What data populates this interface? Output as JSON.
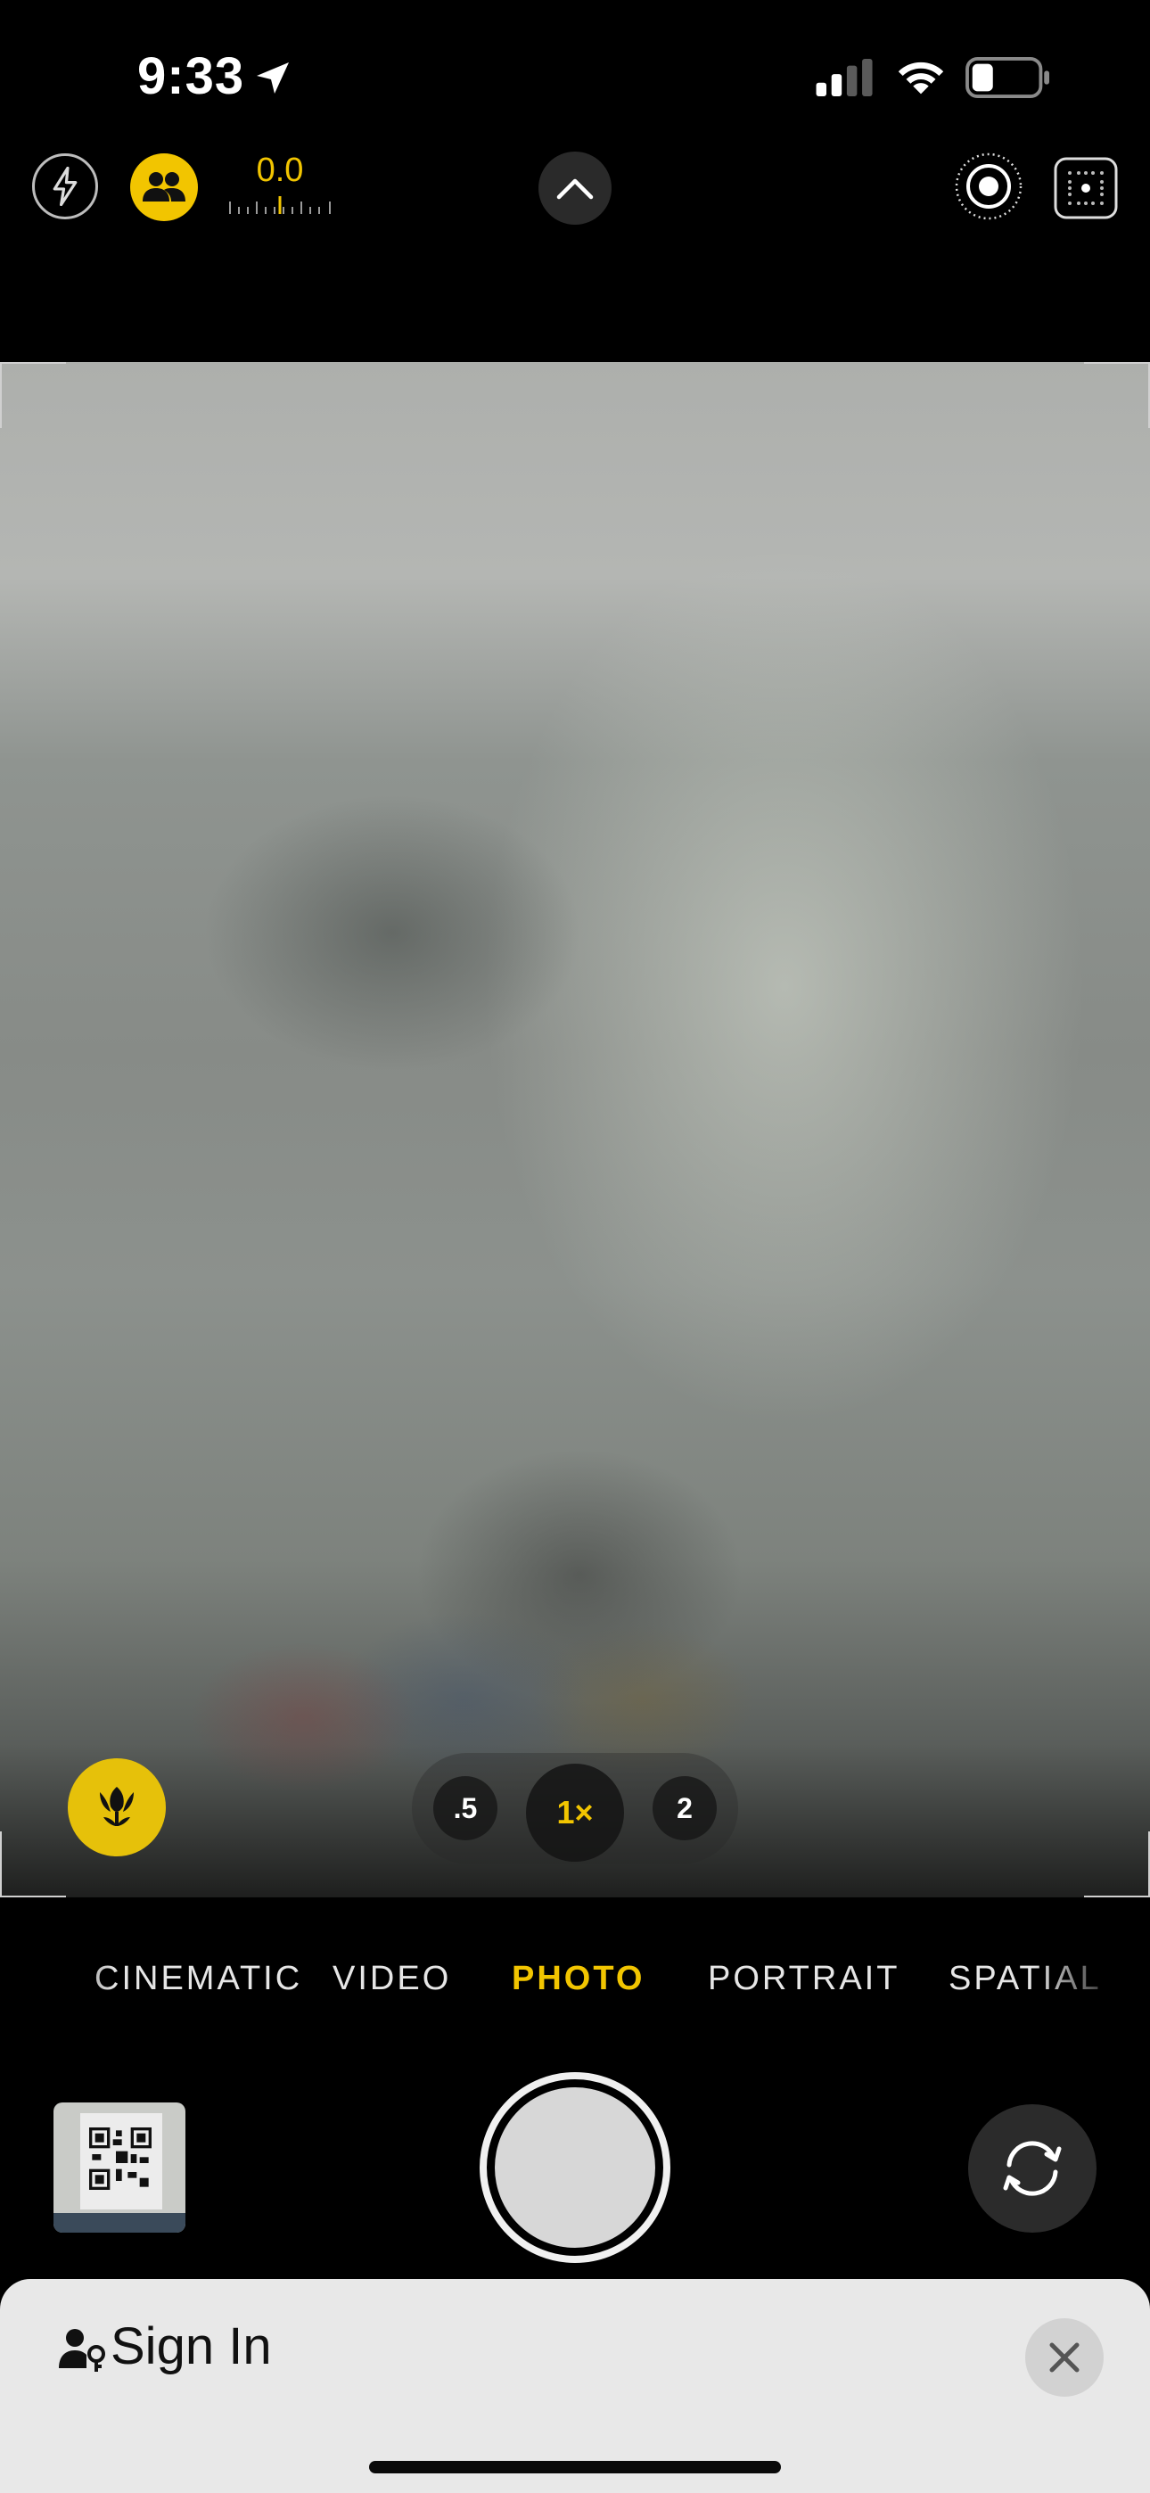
{
  "status_bar": {
    "time": "9:33"
  },
  "top_controls": {
    "exposure_value": "0.0"
  },
  "zoom": {
    "options": [
      ".5",
      "1×",
      "2"
    ],
    "selected": "1×"
  },
  "modes": {
    "items": [
      "CINEMATIC",
      "VIDEO",
      "PHOTO",
      "PORTRAIT",
      "SPATIAL"
    ],
    "selected": "PHOTO"
  },
  "sheet": {
    "title": "Sign In"
  },
  "colors": {
    "accent": "#f2c500",
    "sheet_bg": "#e8e8e8"
  },
  "icons": [
    "location-arrow-icon",
    "cellular-signal-icon",
    "wifi-icon",
    "battery-icon",
    "flash-icon",
    "people-icon",
    "chevron-up-icon",
    "live-photo-icon",
    "grid-icon",
    "macro-flower-icon",
    "camera-flip-icon",
    "person-key-icon",
    "close-icon"
  ]
}
